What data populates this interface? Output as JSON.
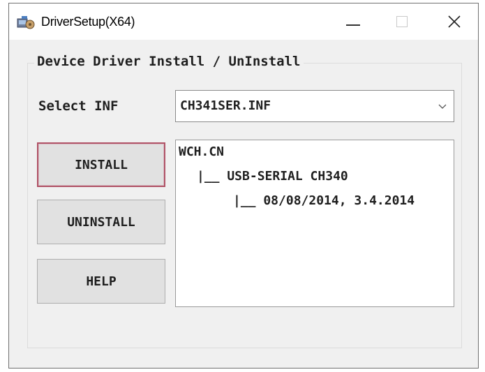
{
  "window": {
    "title": "DriverSetup(X64)",
    "app_icon": "driver-setup-icon",
    "controls": {
      "minimize_icon": "minimize-icon",
      "maximize_icon": "maximize-icon",
      "close_icon": "close-icon",
      "close_glyph": "✕"
    }
  },
  "group": {
    "title": "Device Driver Install / UnInstall"
  },
  "inf_select": {
    "label": "Select INF",
    "value": "CH341SER.INF",
    "arrow_icon": "chevron-down-icon"
  },
  "buttons": {
    "install": "INSTALL",
    "uninstall": "UNINSTALL",
    "help": "HELP"
  },
  "driver_info": {
    "lines": [
      "WCH.CN",
      "|__ USB-SERIAL CH340",
      "|__ 08/08/2014, 3.4.2014"
    ]
  },
  "colors": {
    "install_focus_border": "#b05266",
    "dialog_background": "#f0f0f0"
  }
}
